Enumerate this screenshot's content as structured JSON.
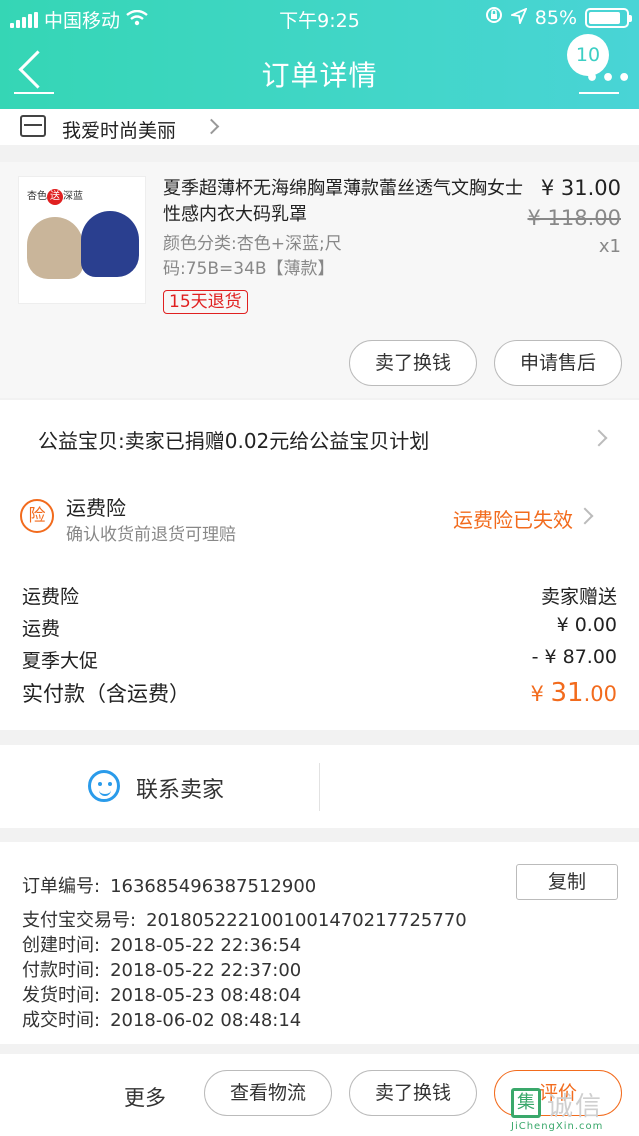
{
  "status_bar": {
    "carrier": "中国移动",
    "time": "下午9:25",
    "battery_text": "85%",
    "battery_level": 0.85
  },
  "nav": {
    "title": "订单详情",
    "badge_count": "10",
    "more_dots": "•••"
  },
  "shop": {
    "name": "我爱时尚美丽"
  },
  "item": {
    "image_tag_a": "杏色",
    "image_tag_b": "送",
    "image_tag_c": "深蓝",
    "title": "夏季超薄杯无海绵胸罩薄款蕾丝透气文胸女士性感内衣大码乳罩",
    "spec": "颜色分类:杏色+深蓝;尺码:75B=34B【薄款】",
    "price": "¥ 31.00",
    "original_price": "¥ 118.00",
    "quantity": "x1",
    "refund_tag": "15天退货",
    "btn_sell": "卖了换钱",
    "btn_aftersale": "申请售后"
  },
  "charity": {
    "text": "公益宝贝:卖家已捐赠0.02元给公益宝贝计划"
  },
  "insurance": {
    "icon_char": "险",
    "title": "运费险",
    "desc": "确认收货前退货可理赔",
    "status": "运费险已失效"
  },
  "fees": [
    {
      "label": "运费险",
      "value": "卖家赠送"
    },
    {
      "label": "运费",
      "value": "¥ 0.00"
    },
    {
      "label": "夏季大促",
      "value": "- ¥ 87.00"
    }
  ],
  "total": {
    "label": "实付款（含运费）",
    "currency": "¥ ",
    "int": "31",
    "dec": ".00"
  },
  "contact": {
    "label": "联系卖家"
  },
  "order_info": {
    "order_no_label": "订单编号:",
    "order_no": "163685496387512900",
    "copy": "复制",
    "alipay_label": "支付宝交易号:",
    "alipay_no": "2018052221001001470217725770",
    "created_label": "创建时间:",
    "created": "2018-05-22 22:36:54",
    "paid_label": "付款时间:",
    "paid": "2018-05-22 22:37:00",
    "shipped_label": "发货时间:",
    "shipped": "2018-05-23 08:48:04",
    "done_label": "成交时间:",
    "done": "2018-06-02 08:48:14"
  },
  "bottom_bar": {
    "more": "更多",
    "logistics": "查看物流",
    "sell": "卖了换钱",
    "review": "评价"
  },
  "watermark": {
    "mark": "集",
    "text": "诚信",
    "url": "JiChengXin.com"
  },
  "colors": {
    "header_from": "#35d6b5",
    "header_to": "#49d4d6",
    "accent_orange": "#f26b1d",
    "refund_red": "#e02020",
    "contact_blue": "#2a9bea"
  }
}
